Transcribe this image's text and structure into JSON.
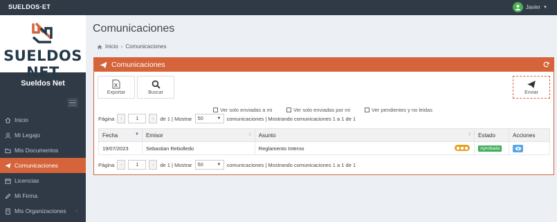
{
  "topbar": {
    "brand": "SUELDOS·ET",
    "user_name": "Javier"
  },
  "sidebar": {
    "logo_text": "SUELDOS NET",
    "title": "Sueldos Net",
    "items": [
      {
        "label": "Inicio",
        "icon": "home-icon"
      },
      {
        "label": "Mi Legajo",
        "icon": "user-icon"
      },
      {
        "label": "Mis Documentos",
        "icon": "folder-icon"
      },
      {
        "label": "Comunicaciones",
        "icon": "paper-plane-icon",
        "active": true
      },
      {
        "label": "Licencias",
        "icon": "calendar-icon"
      },
      {
        "label": "Mi Firma",
        "icon": "pen-icon"
      },
      {
        "label": "Mis Organizaciones",
        "icon": "building-icon"
      }
    ]
  },
  "page": {
    "title": "Comunicaciones",
    "breadcrumb": {
      "home": "Inicio",
      "current": "Comunicaciones"
    }
  },
  "panel": {
    "title": "Comunicaciones",
    "toolbar": {
      "export": "Exportar",
      "search": "Buscar",
      "send": "Enviar"
    },
    "filters": {
      "sent_to_me": "Ver solo enviadas a mi",
      "sent_by_me": "Ver solo enviadas por mi",
      "pending": "Ver pendientes y no leidas"
    },
    "pager": {
      "page_label": "Página",
      "page_value": "1",
      "of_label": "de 1 | Mostrar",
      "page_size": "50",
      "summary": "comunicaciones | Mostrando comunicaciones 1 a 1 de 1"
    },
    "table": {
      "columns": [
        "Fecha",
        "Emisor",
        "Asunto",
        "Estado",
        "Acciones"
      ],
      "rows": [
        {
          "fecha": "19/07/2023",
          "emisor": "Sebastian Rebolledo",
          "asunto": "Reglamento Interno",
          "estado": "Aprobada"
        }
      ]
    }
  },
  "colors": {
    "accent": "#d5643a",
    "sidebar": "#2f3a46",
    "approved": "#3fae5a",
    "view": "#5aa4e8"
  }
}
